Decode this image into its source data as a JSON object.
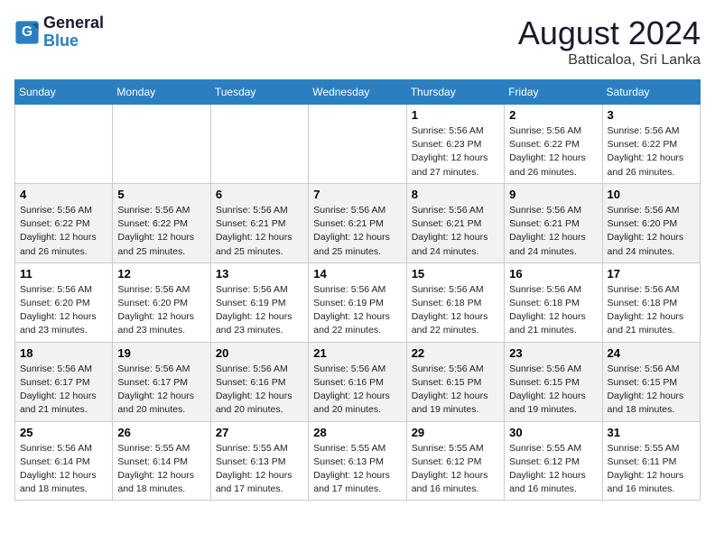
{
  "logo": {
    "line1": "General",
    "line2": "Blue"
  },
  "header": {
    "month_year": "August 2024",
    "location": "Batticaloa, Sri Lanka"
  },
  "weekdays": [
    "Sunday",
    "Monday",
    "Tuesday",
    "Wednesday",
    "Thursday",
    "Friday",
    "Saturday"
  ],
  "weeks": [
    [
      {
        "day": "",
        "info": ""
      },
      {
        "day": "",
        "info": ""
      },
      {
        "day": "",
        "info": ""
      },
      {
        "day": "",
        "info": ""
      },
      {
        "day": "1",
        "info": "Sunrise: 5:56 AM\nSunset: 6:23 PM\nDaylight: 12 hours\nand 27 minutes."
      },
      {
        "day": "2",
        "info": "Sunrise: 5:56 AM\nSunset: 6:22 PM\nDaylight: 12 hours\nand 26 minutes."
      },
      {
        "day": "3",
        "info": "Sunrise: 5:56 AM\nSunset: 6:22 PM\nDaylight: 12 hours\nand 26 minutes."
      }
    ],
    [
      {
        "day": "4",
        "info": "Sunrise: 5:56 AM\nSunset: 6:22 PM\nDaylight: 12 hours\nand 26 minutes."
      },
      {
        "day": "5",
        "info": "Sunrise: 5:56 AM\nSunset: 6:22 PM\nDaylight: 12 hours\nand 25 minutes."
      },
      {
        "day": "6",
        "info": "Sunrise: 5:56 AM\nSunset: 6:21 PM\nDaylight: 12 hours\nand 25 minutes."
      },
      {
        "day": "7",
        "info": "Sunrise: 5:56 AM\nSunset: 6:21 PM\nDaylight: 12 hours\nand 25 minutes."
      },
      {
        "day": "8",
        "info": "Sunrise: 5:56 AM\nSunset: 6:21 PM\nDaylight: 12 hours\nand 24 minutes."
      },
      {
        "day": "9",
        "info": "Sunrise: 5:56 AM\nSunset: 6:21 PM\nDaylight: 12 hours\nand 24 minutes."
      },
      {
        "day": "10",
        "info": "Sunrise: 5:56 AM\nSunset: 6:20 PM\nDaylight: 12 hours\nand 24 minutes."
      }
    ],
    [
      {
        "day": "11",
        "info": "Sunrise: 5:56 AM\nSunset: 6:20 PM\nDaylight: 12 hours\nand 23 minutes."
      },
      {
        "day": "12",
        "info": "Sunrise: 5:56 AM\nSunset: 6:20 PM\nDaylight: 12 hours\nand 23 minutes."
      },
      {
        "day": "13",
        "info": "Sunrise: 5:56 AM\nSunset: 6:19 PM\nDaylight: 12 hours\nand 23 minutes."
      },
      {
        "day": "14",
        "info": "Sunrise: 5:56 AM\nSunset: 6:19 PM\nDaylight: 12 hours\nand 22 minutes."
      },
      {
        "day": "15",
        "info": "Sunrise: 5:56 AM\nSunset: 6:18 PM\nDaylight: 12 hours\nand 22 minutes."
      },
      {
        "day": "16",
        "info": "Sunrise: 5:56 AM\nSunset: 6:18 PM\nDaylight: 12 hours\nand 21 minutes."
      },
      {
        "day": "17",
        "info": "Sunrise: 5:56 AM\nSunset: 6:18 PM\nDaylight: 12 hours\nand 21 minutes."
      }
    ],
    [
      {
        "day": "18",
        "info": "Sunrise: 5:56 AM\nSunset: 6:17 PM\nDaylight: 12 hours\nand 21 minutes."
      },
      {
        "day": "19",
        "info": "Sunrise: 5:56 AM\nSunset: 6:17 PM\nDaylight: 12 hours\nand 20 minutes."
      },
      {
        "day": "20",
        "info": "Sunrise: 5:56 AM\nSunset: 6:16 PM\nDaylight: 12 hours\nand 20 minutes."
      },
      {
        "day": "21",
        "info": "Sunrise: 5:56 AM\nSunset: 6:16 PM\nDaylight: 12 hours\nand 20 minutes."
      },
      {
        "day": "22",
        "info": "Sunrise: 5:56 AM\nSunset: 6:15 PM\nDaylight: 12 hours\nand 19 minutes."
      },
      {
        "day": "23",
        "info": "Sunrise: 5:56 AM\nSunset: 6:15 PM\nDaylight: 12 hours\nand 19 minutes."
      },
      {
        "day": "24",
        "info": "Sunrise: 5:56 AM\nSunset: 6:15 PM\nDaylight: 12 hours\nand 18 minutes."
      }
    ],
    [
      {
        "day": "25",
        "info": "Sunrise: 5:56 AM\nSunset: 6:14 PM\nDaylight: 12 hours\nand 18 minutes."
      },
      {
        "day": "26",
        "info": "Sunrise: 5:55 AM\nSunset: 6:14 PM\nDaylight: 12 hours\nand 18 minutes."
      },
      {
        "day": "27",
        "info": "Sunrise: 5:55 AM\nSunset: 6:13 PM\nDaylight: 12 hours\nand 17 minutes."
      },
      {
        "day": "28",
        "info": "Sunrise: 5:55 AM\nSunset: 6:13 PM\nDaylight: 12 hours\nand 17 minutes."
      },
      {
        "day": "29",
        "info": "Sunrise: 5:55 AM\nSunset: 6:12 PM\nDaylight: 12 hours\nand 16 minutes."
      },
      {
        "day": "30",
        "info": "Sunrise: 5:55 AM\nSunset: 6:12 PM\nDaylight: 12 hours\nand 16 minutes."
      },
      {
        "day": "31",
        "info": "Sunrise: 5:55 AM\nSunset: 6:11 PM\nDaylight: 12 hours\nand 16 minutes."
      }
    ]
  ]
}
